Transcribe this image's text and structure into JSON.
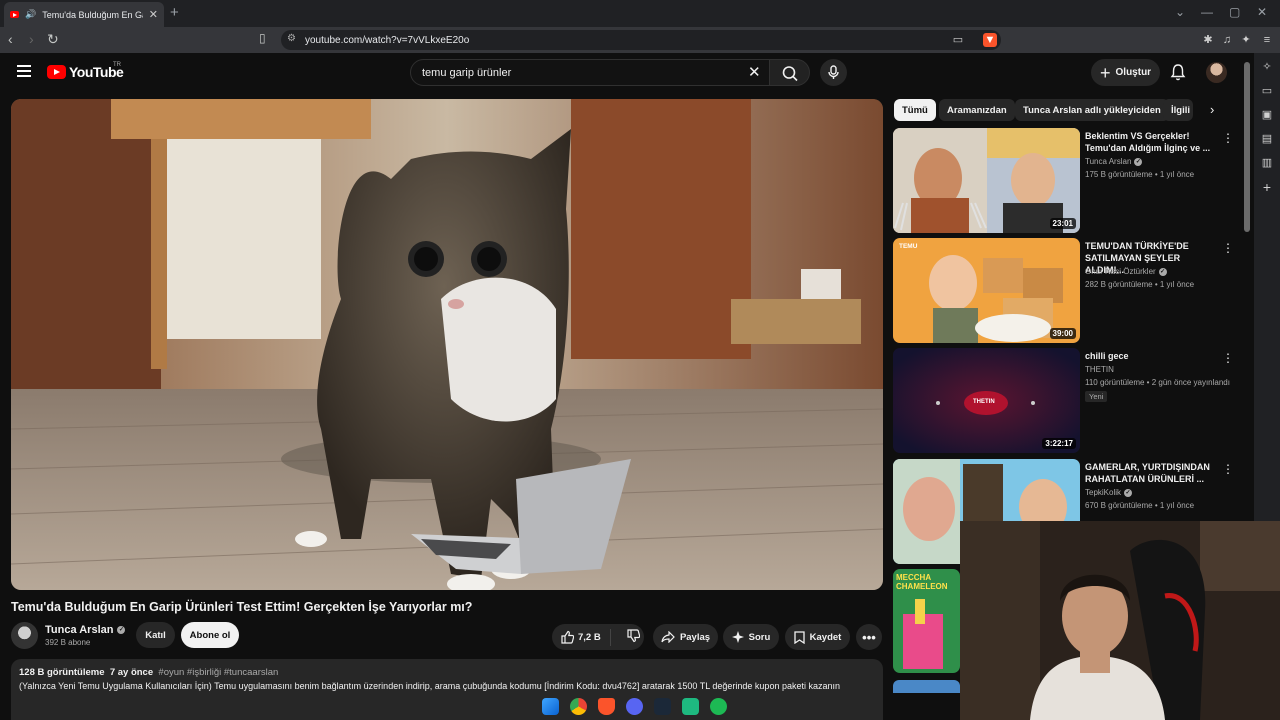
{
  "browser": {
    "tab_title": "Temu'da Bulduğum En Garip",
    "url": "youtube.com/watch?v=7vVLkxeE20o"
  },
  "header": {
    "logo_text": "YouTube",
    "region": "TR",
    "search_query": "temu garip ürünler",
    "create_label": "Oluştur"
  },
  "video": {
    "title": "Temu'da Bulduğum En Garip Ürünleri Test Ettim! Gerçekten İşe Yarıyorlar mı?",
    "channel": "Tunca Arslan",
    "subscribers": "392 B abone",
    "join_label": "Katıl",
    "subscribe_label": "Abone ol",
    "likes": "7,2 B",
    "share_label": "Paylaş",
    "ask_label": "Soru",
    "save_label": "Kaydet",
    "views": "128 B görüntüleme",
    "age": "7 ay önce",
    "tags": "#oyun #işbirliği #tuncaarslan",
    "description": "(Yalnızca Yeni Temu Uygulama Kullanıcıları İçin) Temu uygulamasını benim bağlantım üzerinden indirip, arama çubuğunda kodumu [İndirim Kodu: dvu4762] aratarak 1500 TL değerinde kupon paketi kazanın"
  },
  "chips": [
    "Tümü",
    "Aramanızdan",
    "Tunca Arslan adlı yükleyiciden",
    "İlgili"
  ],
  "recommendations": [
    {
      "title": "Beklentim VS Gerçekler! Temu'dan Aldığım İlginç ve ...",
      "channel": "Tunca Arslan",
      "verified": true,
      "meta": "175 B görüntüleme • 1 yıl önce",
      "duration": "23:01"
    },
    {
      "title": "TEMU'DAN TÜRKİYE'DE SATILMAYAN ŞEYLER ALDIM!...",
      "channel": "Onur Naci Öztürkler",
      "verified": true,
      "meta": "282 B görüntüleme • 1 yıl önce",
      "duration": "39:00"
    },
    {
      "title": "chilli gece",
      "channel": "THETIN",
      "verified": false,
      "meta": "110 görüntüleme • 2 gün önce yayınlandı",
      "duration": "3:22:17",
      "badge": "Yeni"
    },
    {
      "title": "GAMERLAR, YURTDIŞINDAN RAHATLATAN ÜRÜNLERİ ...",
      "channel": "TepkiKolik",
      "verified": true,
      "meta": "670 B görüntüleme • 1 yıl önce",
      "duration": ""
    }
  ],
  "thumb_texts": {
    "temu_small": "TEMU",
    "chameleon": "MECCHA CHAMELEON",
    "thetin_logo": "THETIN"
  },
  "icons": [
    "menu-icon",
    "search-icon",
    "mic-icon",
    "bell-icon",
    "like-icon",
    "dislike-icon",
    "share-icon",
    "sparkle-icon",
    "save-icon"
  ],
  "colors": {
    "bg": "#0f0f0f",
    "surface": "#272727",
    "brand": "#ff0000",
    "text": "#f1f1f1",
    "muted": "#aaaaaa"
  }
}
